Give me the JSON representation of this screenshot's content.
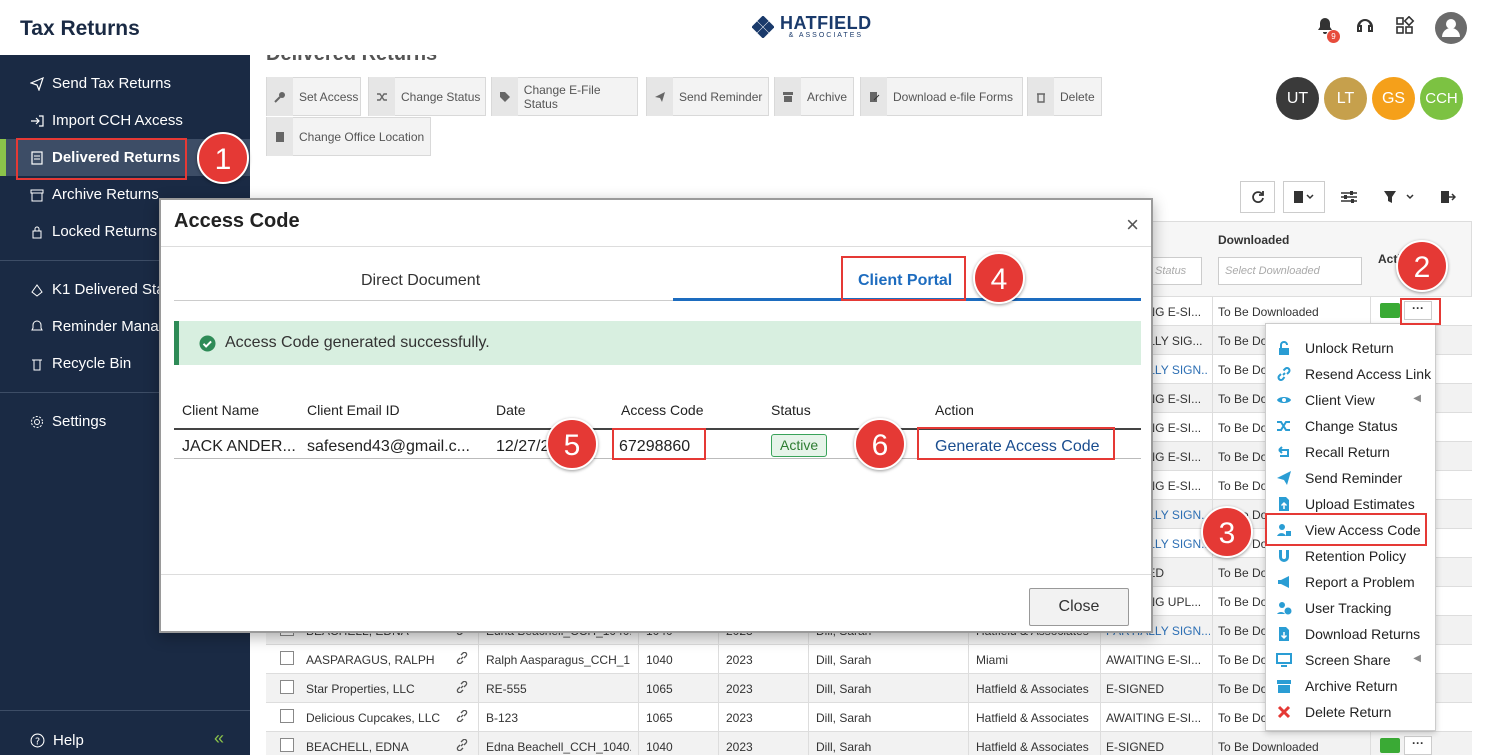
{
  "app": {
    "title": "Tax Returns",
    "logo_name": "HATFIELD",
    "logo_sub": "& ASSOCIATES",
    "notification_count": "9"
  },
  "sidebar": {
    "items": [
      {
        "label": "Send Tax Returns"
      },
      {
        "label": "Import CCH Axcess"
      },
      {
        "label": "Delivered Returns"
      },
      {
        "label": "Archive Returns"
      },
      {
        "label": "Locked Returns"
      },
      {
        "label": "K1 Delivered Sta"
      },
      {
        "label": "Reminder Manag"
      },
      {
        "label": "Recycle Bin"
      },
      {
        "label": "Settings"
      }
    ],
    "help": "Help"
  },
  "main": {
    "title": "Delivered Returns",
    "toolbar": [
      "Set Access",
      "Change Status",
      "Change E-File Status",
      "Send Reminder",
      "Archive",
      "Download e-file Forms",
      "Delete",
      "Change Office Location"
    ],
    "users": [
      {
        "initials": "UT",
        "color": "#3a3a3a"
      },
      {
        "initials": "LT",
        "color": "#c6a04c"
      },
      {
        "initials": "GS",
        "color": "#f5a01a"
      },
      {
        "initials": "CCH",
        "color": "#7cc242"
      }
    ],
    "table_header": {
      "downloaded": "Downloaded",
      "downloaded_placeholder": "Select Downloaded",
      "status_placeholder": "Status",
      "actions": "Actions"
    },
    "rows_partial": [
      {
        "status": "AWAITING E-SI...",
        "downloaded": "To Be Downloaded"
      },
      {
        "status": "PARTIALLY SIG...",
        "downloaded": "To Be Do"
      },
      {
        "status": "PARTIALLY SIGN...",
        "downloaded": "To Be Do"
      },
      {
        "status": "AWAITING E-SI...",
        "downloaded": "To Be Do"
      },
      {
        "status": "AWAITING E-SI...",
        "downloaded": "To Be Do"
      },
      {
        "status": "AWAITING E-SI...",
        "downloaded": "To Be Do"
      },
      {
        "status": "AWAITING E-SI...",
        "downloaded": "To Be Do"
      },
      {
        "status": "PARTIALLY SIGN...",
        "downloaded": "To Be Do"
      },
      {
        "status": "PARTIALLY SIGN...",
        "downloaded": "To Be Do"
      },
      {
        "status": "E-SIGNED",
        "downloaded": "To Be Do"
      },
      {
        "status": "AWAITING UPL...",
        "downloaded": "To Be Do"
      }
    ],
    "rows": [
      {
        "client": "BEACHELL, EDNA",
        "name": "Edna Beachell_CCH_1040...",
        "form": "1040",
        "year": "2023",
        "ero": "Dill, Sarah",
        "office": "Hatfield & Associates",
        "status": "PARTIALLY SIGN...",
        "downloaded": "To Be Do"
      },
      {
        "client": "AASPARAGUS, RALPH",
        "name": "Ralph Aasparagus_CCH_1...",
        "form": "1040",
        "year": "2023",
        "ero": "Dill, Sarah",
        "office": "Miami",
        "status": "AWAITING E-SI...",
        "downloaded": "To Be Do"
      },
      {
        "client": "Star Properties, LLC",
        "name": "RE-555",
        "form": "1065",
        "year": "2023",
        "ero": "Dill, Sarah",
        "office": "Hatfield & Associates",
        "status": "E-SIGNED",
        "downloaded": "To Be Do"
      },
      {
        "client": "Delicious Cupcakes, LLC",
        "name": "B-123",
        "form": "1065",
        "year": "2023",
        "ero": "Dill, Sarah",
        "office": "Hatfield & Associates",
        "status": "AWAITING E-SI...",
        "downloaded": "To Be Do"
      },
      {
        "client": "BEACHELL, EDNA",
        "name": "Edna Beachell_CCH_1040...",
        "form": "1040",
        "year": "2023",
        "ero": "Dill, Sarah",
        "office": "Hatfield & Associates",
        "status": "E-SIGNED",
        "downloaded": "To Be Downloaded"
      }
    ]
  },
  "menu": {
    "items": [
      {
        "label": "Unlock Return",
        "icon": "unlock-icon"
      },
      {
        "label": "Resend Access Link",
        "icon": "link-icon"
      },
      {
        "label": "Client View",
        "icon": "eye-icon"
      },
      {
        "label": "Change Status",
        "icon": "shuffle-icon"
      },
      {
        "label": "Recall Return",
        "icon": "recall-icon"
      },
      {
        "label": "Send Reminder",
        "icon": "paper-plane-icon"
      },
      {
        "label": "Upload Estimates",
        "icon": "upload-file-icon"
      },
      {
        "label": "View Access Code",
        "icon": "user-lock-icon"
      },
      {
        "label": "Retention Policy",
        "icon": "magnet-icon"
      },
      {
        "label": "Report a Problem",
        "icon": "megaphone-icon"
      },
      {
        "label": "User Tracking",
        "icon": "user-clock-icon"
      },
      {
        "label": "Download Returns",
        "icon": "download-file-icon"
      },
      {
        "label": "Screen Share",
        "icon": "monitor-icon"
      },
      {
        "label": "Archive Return",
        "icon": "archive-icon"
      },
      {
        "label": "Delete Return",
        "icon": "x-icon"
      }
    ]
  },
  "modal": {
    "title": "Access Code",
    "tabs": [
      "Direct Document",
      "Client Portal"
    ],
    "alert": "Access Code generated successfully.",
    "columns": [
      "Client Name",
      "Client Email ID",
      "Date",
      "Access Code",
      "Status",
      "Action"
    ],
    "row": {
      "client": "JACK ANDER...",
      "email": "safesend43@gmail.c...",
      "date": "12/27/2",
      "code": "67298860",
      "status": "Active",
      "action": "Generate Access Code"
    },
    "close": "Close"
  },
  "callouts": [
    "1",
    "2",
    "3",
    "4",
    "5",
    "6"
  ],
  "colors": {
    "sidebar": "#1a2a44",
    "accent_green": "#8bc34a",
    "link_blue": "#1d6cbf",
    "callout_red": "#e53935"
  }
}
